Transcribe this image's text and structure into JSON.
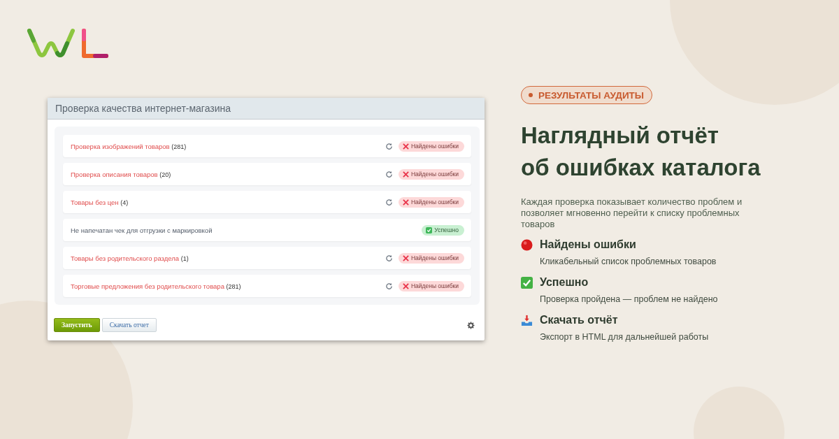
{
  "window": {
    "title": "Проверка качества интернет-магазина"
  },
  "checks": [
    {
      "kind": "error",
      "title": "Проверка изображений товаров",
      "count": "(281)",
      "status": "Найдены ошибки"
    },
    {
      "kind": "error",
      "title": "Проверка описания товаров",
      "count": "(20)",
      "status": "Найдены ошибки"
    },
    {
      "kind": "error",
      "title": "Товары без цен",
      "count": "(4)",
      "status": "Найдены ошибки"
    },
    {
      "kind": "success",
      "title": "Не напечатан чек для отгрузки с маркировкой",
      "status": "Успешно"
    },
    {
      "kind": "error",
      "title": "Товары без родительского раздела",
      "count": "(1)",
      "status": "Найдены ошибки"
    },
    {
      "kind": "error",
      "title": "Торговые предложения без родительского товара",
      "count": "(281)",
      "status": "Найдены ошибки"
    }
  ],
  "buttons": {
    "run": "Запустить",
    "download": "Скачать отчет"
  },
  "badge": "РЕЗУЛЬТАТЫ АУДИТЫ",
  "headline": [
    "Наглядный отчёт",
    "об ошибках каталога"
  ],
  "description": "Каждая проверка показывает количество проблем и позволяет мгновенно перейти к списку проблемных товаров",
  "legend": [
    {
      "kind": "error",
      "title": "Найдены ошибки",
      "text": "Кликабельный список проблемных товаров"
    },
    {
      "kind": "success",
      "title": "Успешно",
      "text": "Проверка пройдена — проблем не найдено"
    },
    {
      "kind": "download",
      "title": "Скачать отчёт",
      "text": "Экспорт в HTML для дальнейшей работы"
    }
  ]
}
